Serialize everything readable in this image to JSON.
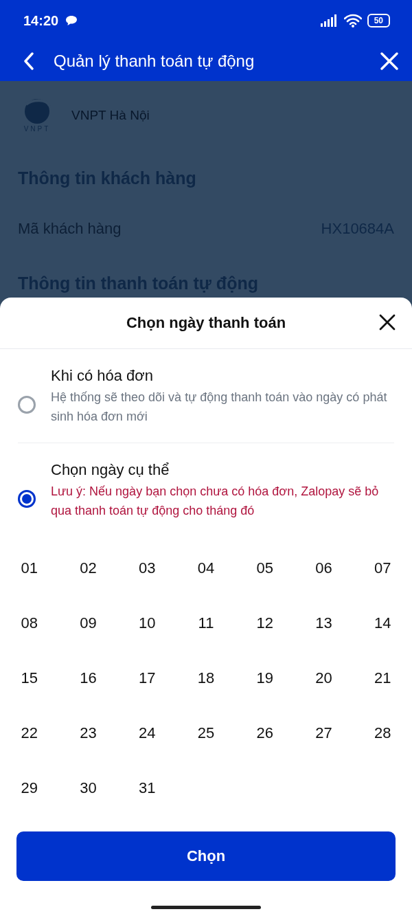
{
  "status_bar": {
    "time": "14:20",
    "battery": "50"
  },
  "header": {
    "title": "Quản lý thanh toán tự động"
  },
  "background": {
    "provider": "VNPT Hà Nội",
    "logo_text": "VNPT",
    "section_title": "Thông tin khách hàng",
    "fields": [
      {
        "label": "Mã khách hàng",
        "value": "HX10684A"
      }
    ],
    "next_section_title": "Thông tin thanh toán tự động"
  },
  "sheet": {
    "title": "Chọn ngày thanh toán",
    "options": [
      {
        "label": "Khi có hóa đơn",
        "description": "Hệ thống sẽ theo dõi và tự động thanh toán vào ngày có phát sinh hóa đơn mới",
        "kind": "info",
        "selected": false
      },
      {
        "label": "Chọn ngày cụ thể",
        "description": "Lưu ý: Nếu ngày bạn chọn chưa có hóa đơn, Zalopay sẽ bỏ qua thanh toán tự động cho tháng đó",
        "kind": "warning",
        "selected": true
      }
    ],
    "days": [
      {
        "label": "01",
        "selected": false
      },
      {
        "label": "02",
        "selected": false
      },
      {
        "label": "03",
        "selected": false
      },
      {
        "label": "04",
        "selected": false
      },
      {
        "label": "05",
        "selected": false
      },
      {
        "label": "06",
        "selected": false
      },
      {
        "label": "07",
        "selected": false
      },
      {
        "label": "08",
        "selected": false
      },
      {
        "label": "09",
        "selected": false
      },
      {
        "label": "10",
        "selected": false
      },
      {
        "label": "11",
        "selected": false
      },
      {
        "label": "12",
        "selected": false
      },
      {
        "label": "13",
        "selected": false
      },
      {
        "label": "14",
        "selected": false
      },
      {
        "label": "15",
        "selected": false
      },
      {
        "label": "16",
        "selected": false
      },
      {
        "label": "17",
        "selected": false
      },
      {
        "label": "18",
        "selected": false
      },
      {
        "label": "19",
        "selected": false
      },
      {
        "label": "20",
        "selected": false
      },
      {
        "label": "21",
        "selected": false
      },
      {
        "label": "22",
        "selected": false
      },
      {
        "label": "23",
        "selected": false
      },
      {
        "label": "24",
        "selected": false
      },
      {
        "label": "25",
        "selected": false
      },
      {
        "label": "26",
        "selected": false
      },
      {
        "label": "27",
        "selected": false
      },
      {
        "label": "28",
        "selected": false
      },
      {
        "label": "29",
        "selected": false
      },
      {
        "label": "30",
        "selected": false
      },
      {
        "label": "31",
        "selected": false
      }
    ],
    "confirm_button": "Chọn"
  }
}
